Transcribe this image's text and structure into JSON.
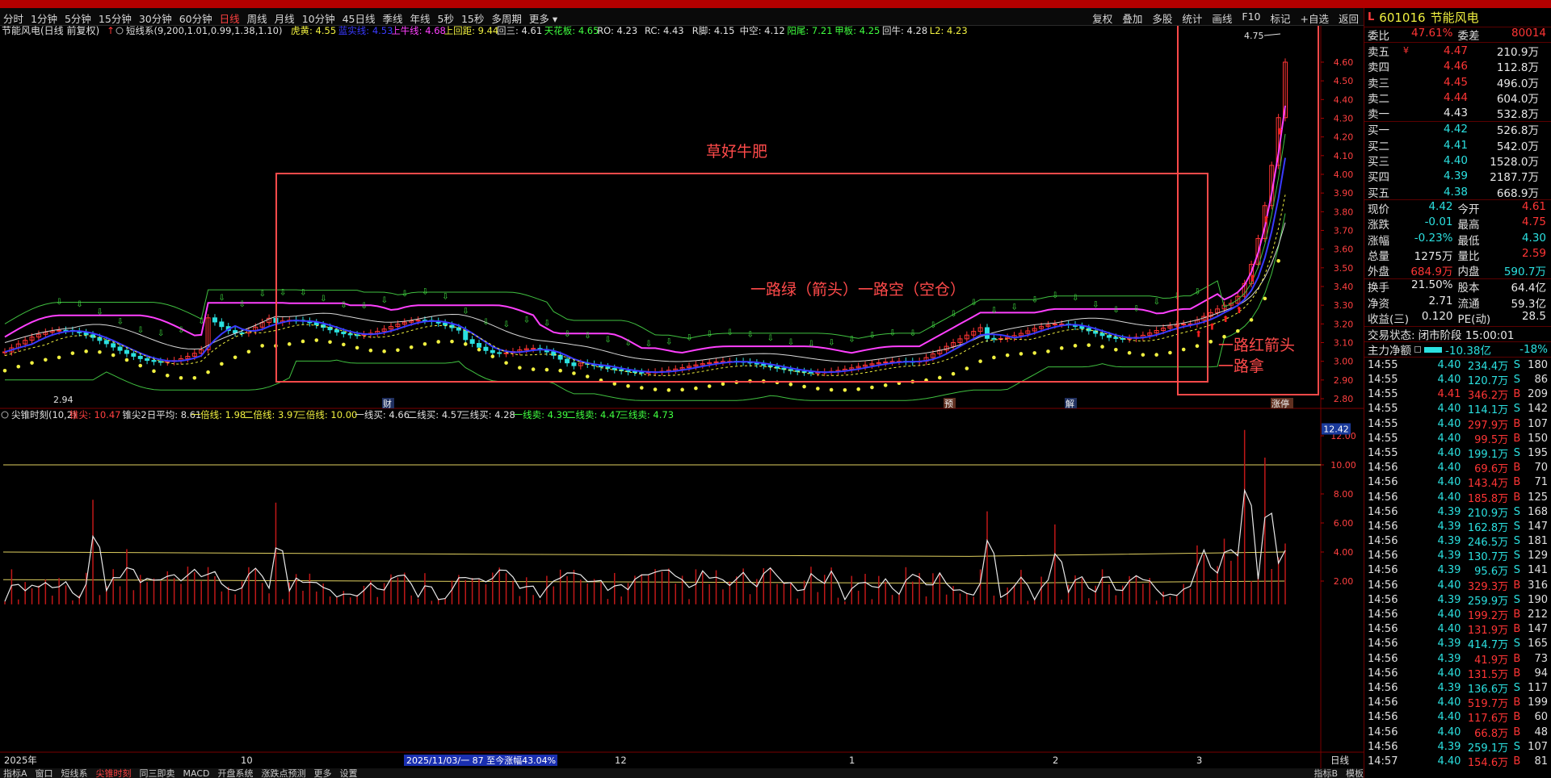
{
  "toolbar": {
    "periods": [
      "分时",
      "1分钟",
      "5分钟",
      "15分钟",
      "30分钟",
      "60分钟",
      "日线",
      "周线",
      "月线",
      "10分钟",
      "45日线",
      "季线",
      "年线",
      "5秒",
      "15秒",
      "多周期",
      "更多 ▾"
    ],
    "active_period": "日线",
    "actions": [
      "复权",
      "叠加",
      "多股",
      "统计",
      "画线",
      "F10",
      "标记",
      "+自选",
      "返回"
    ]
  },
  "top_chart": {
    "stock_title": "节能风电(日线 前复权)",
    "indicator_line": [
      {
        "text": "短线系(9,200,1.01,0.99,1.38,1.10)",
        "color": "#e0e0e0"
      },
      {
        "text": "虎黄: 4.55",
        "color": "#f0f040"
      },
      {
        "text": "蓝实线: 4.53",
        "color": "#3a3aff"
      },
      {
        "text": "上牛线: 4.68",
        "color": "#ff40ff"
      },
      {
        "text": "上回距: 9.44",
        "color": "#f0f040"
      },
      {
        "text": "回三: 4.61",
        "color": "#e0e0e0"
      },
      {
        "text": "天花板: 4.65",
        "color": "#40ff40"
      },
      {
        "text": "RO: 4.23",
        "color": "#e0e0e0"
      },
      {
        "text": "RC: 4.43",
        "color": "#e0e0e0"
      },
      {
        "text": "R脚: 4.15",
        "color": "#e0e0e0"
      },
      {
        "text": "中空: 4.12",
        "color": "#e0e0e0"
      },
      {
        "text": "阳尾: 7.21",
        "color": "#40ff40"
      },
      {
        "text": "甲板: 4.25",
        "color": "#40ff40"
      },
      {
        "text": "回牛: 4.28",
        "color": "#e0e0e0"
      },
      {
        "text": "L2: 4.23",
        "color": "#f0f040"
      }
    ],
    "price_axis": [
      "4.60",
      "4.50",
      "4.40",
      "4.30",
      "4.20",
      "4.10",
      "4.00",
      "3.90",
      "3.80",
      "3.70",
      "3.60",
      "3.50",
      "3.40",
      "3.30",
      "3.20",
      "3.10",
      "3.00",
      "2.90",
      "2.80"
    ],
    "high_label": "4.75",
    "low_label": "2.94",
    "annotations": {
      "box_title": "草好牛肥",
      "box_caption": "一路绿（箭头）一路空（空仓）",
      "right_caption_1": "一路红箭头",
      "right_caption_2": "一路拿"
    },
    "event_markers": [
      "财",
      "预",
      "解",
      "涨停"
    ]
  },
  "bottom_chart": {
    "indicator_line": [
      {
        "text": "尖锥时刻(10,2)",
        "color": "#e0e0e0"
      },
      {
        "text": "锥尖: 10.47",
        "color": "#ff4040"
      },
      {
        "text": "锥尖2日平均: 8.61",
        "color": "#e0e0e0"
      },
      {
        "text": "一倍线: 1.98",
        "color": "#f0f040"
      },
      {
        "text": "二倍线: 3.97",
        "color": "#f0f040"
      },
      {
        "text": "三倍线: 10.00",
        "color": "#f0f040"
      },
      {
        "text": "一线买: 4.66",
        "color": "#e0e0e0"
      },
      {
        "text": "二线买: 4.57",
        "color": "#e0e0e0"
      },
      {
        "text": "三线买: 4.28",
        "color": "#e0e0e0"
      },
      {
        "text": "一线卖: 4.39",
        "color": "#40ff40"
      },
      {
        "text": "二线卖: 4.47",
        "color": "#40ff40"
      },
      {
        "text": "三线卖: 4.73",
        "color": "#40ff40"
      }
    ],
    "axis": [
      "12.00",
      "10.00",
      "8.00",
      "6.00",
      "4.00",
      "2.00"
    ],
    "current_value": "12.42"
  },
  "time_axis": {
    "labels": [
      "2025年",
      "10",
      "12",
      "1",
      "2",
      "3"
    ],
    "range_label": "2025/11/03/一 87 至今涨幅43.04%",
    "period_label": "日线"
  },
  "bottom_tabs": [
    "指标A",
    "窗口",
    "短线系",
    "尖锥时刻",
    "同三即卖",
    "MACD",
    "开盘系统",
    "涨跌点预测",
    "更多",
    "设置"
  ],
  "bottom_tabs_active": "尖锥时刻",
  "bottom_tabs_right": [
    "指标B",
    "模板"
  ],
  "quote": {
    "code": "601016",
    "name": "节能风电",
    "ratio_label": "委比",
    "ratio": "47.61%",
    "diff_label": "委差",
    "diff": "80014",
    "asks": [
      {
        "label": "卖五",
        "flag": "¥",
        "price": "4.47",
        "vol": "210.9万"
      },
      {
        "label": "卖四",
        "flag": "",
        "price": "4.46",
        "vol": "112.8万"
      },
      {
        "label": "卖三",
        "flag": "",
        "price": "4.45",
        "vol": "496.0万"
      },
      {
        "label": "卖二",
        "flag": "",
        "price": "4.44",
        "vol": "604.0万"
      },
      {
        "label": "卖一",
        "flag": "",
        "price": "4.43",
        "vol": "532.8万"
      }
    ],
    "bids": [
      {
        "label": "买一",
        "price": "4.42",
        "vol": "526.8万"
      },
      {
        "label": "买二",
        "price": "4.41",
        "vol": "542.0万"
      },
      {
        "label": "买三",
        "price": "4.40",
        "vol": "1528.0万"
      },
      {
        "label": "买四",
        "price": "4.39",
        "vol": "2187.7万"
      },
      {
        "label": "买五",
        "price": "4.38",
        "vol": "668.9万"
      }
    ],
    "stats": [
      [
        {
          "k": "现价",
          "v": "4.42",
          "c": "green"
        },
        {
          "k": "今开",
          "v": "4.61",
          "c": "red"
        }
      ],
      [
        {
          "k": "涨跌",
          "v": "-0.01",
          "c": "green"
        },
        {
          "k": "最高",
          "v": "4.75",
          "c": "red"
        }
      ],
      [
        {
          "k": "涨幅",
          "v": "-0.23%",
          "c": "green"
        },
        {
          "k": "最低",
          "v": "4.30",
          "c": "green"
        }
      ],
      [
        {
          "k": "总量",
          "v": "1275万",
          "c": "white"
        },
        {
          "k": "量比",
          "v": "2.59",
          "c": "red"
        }
      ],
      [
        {
          "k": "外盘",
          "v": "684.9万",
          "c": "red"
        },
        {
          "k": "内盘",
          "v": "590.7万",
          "c": "green"
        }
      ]
    ],
    "stats2": [
      [
        {
          "k": "换手",
          "v": "21.50%",
          "c": "white"
        },
        {
          "k": "股本",
          "v": "64.4亿",
          "c": "white"
        }
      ],
      [
        {
          "k": "净资",
          "v": "2.71",
          "c": "white"
        },
        {
          "k": "流通",
          "v": "59.3亿",
          "c": "white"
        }
      ],
      [
        {
          "k": "收益(三)",
          "v": "0.120",
          "c": "white"
        },
        {
          "k": "PE(动)",
          "v": "28.5",
          "c": "white"
        }
      ]
    ],
    "status_label": "交易状态:",
    "status_value": "闭市阶段 15:00:01",
    "flow_label": "主力净额",
    "flow_value": "-10.38亿",
    "flow_pct": "-18%",
    "trades": [
      {
        "t": "14:55",
        "p": "4.40",
        "v": "234.4万",
        "bs": "S",
        "n": "180"
      },
      {
        "t": "14:55",
        "p": "4.40",
        "v": "120.7万",
        "bs": "S",
        "n": "86"
      },
      {
        "t": "14:55",
        "p": "4.41",
        "v": "346.2万",
        "bs": "B",
        "n": "209"
      },
      {
        "t": "14:55",
        "p": "4.40",
        "v": "114.1万",
        "bs": "S",
        "n": "142"
      },
      {
        "t": "14:55",
        "p": "4.40",
        "v": "297.9万",
        "bs": "B",
        "n": "107"
      },
      {
        "t": "14:55",
        "p": "4.40",
        "v": "99.5万",
        "bs": "B",
        "n": "150"
      },
      {
        "t": "14:55",
        "p": "4.40",
        "v": "199.1万",
        "bs": "S",
        "n": "195"
      },
      {
        "t": "14:56",
        "p": "4.40",
        "v": "69.6万",
        "bs": "B",
        "n": "70"
      },
      {
        "t": "14:56",
        "p": "4.40",
        "v": "143.4万",
        "bs": "B",
        "n": "71"
      },
      {
        "t": "14:56",
        "p": "4.40",
        "v": "185.8万",
        "bs": "B",
        "n": "125"
      },
      {
        "t": "14:56",
        "p": "4.39",
        "v": "210.9万",
        "bs": "S",
        "n": "168"
      },
      {
        "t": "14:56",
        "p": "4.39",
        "v": "162.8万",
        "bs": "S",
        "n": "147"
      },
      {
        "t": "14:56",
        "p": "4.39",
        "v": "246.5万",
        "bs": "S",
        "n": "181"
      },
      {
        "t": "14:56",
        "p": "4.39",
        "v": "130.7万",
        "bs": "S",
        "n": "129"
      },
      {
        "t": "14:56",
        "p": "4.39",
        "v": "95.6万",
        "bs": "S",
        "n": "141"
      },
      {
        "t": "14:56",
        "p": "4.40",
        "v": "329.3万",
        "bs": "B",
        "n": "316"
      },
      {
        "t": "14:56",
        "p": "4.39",
        "v": "259.9万",
        "bs": "S",
        "n": "190"
      },
      {
        "t": "14:56",
        "p": "4.40",
        "v": "199.2万",
        "bs": "B",
        "n": "212"
      },
      {
        "t": "14:56",
        "p": "4.40",
        "v": "131.9万",
        "bs": "B",
        "n": "147"
      },
      {
        "t": "14:56",
        "p": "4.39",
        "v": "414.7万",
        "bs": "S",
        "n": "165"
      },
      {
        "t": "14:56",
        "p": "4.39",
        "v": "41.9万",
        "bs": "B",
        "n": "73"
      },
      {
        "t": "14:56",
        "p": "4.40",
        "v": "131.5万",
        "bs": "B",
        "n": "94"
      },
      {
        "t": "14:56",
        "p": "4.39",
        "v": "136.6万",
        "bs": "S",
        "n": "117"
      },
      {
        "t": "14:56",
        "p": "4.40",
        "v": "519.7万",
        "bs": "B",
        "n": "199"
      },
      {
        "t": "14:56",
        "p": "4.40",
        "v": "117.6万",
        "bs": "B",
        "n": "60"
      },
      {
        "t": "14:56",
        "p": "4.40",
        "v": "66.8万",
        "bs": "B",
        "n": "48"
      },
      {
        "t": "14:56",
        "p": "4.39",
        "v": "259.1万",
        "bs": "S",
        "n": "107"
      },
      {
        "t": "14:57",
        "p": "4.40",
        "v": "154.6万",
        "bs": "B",
        "n": "81"
      }
    ]
  },
  "colors": {
    "up": "#ff3535",
    "down": "#2be0e0",
    "annotation": "#ff4a4a",
    "ma_magenta": "#ff40ff",
    "ma_blue": "#3a3aff",
    "ma_green": "#40c040",
    "ma_white": "#d8d8d8",
    "ma_yellow": "#f0f040"
  }
}
